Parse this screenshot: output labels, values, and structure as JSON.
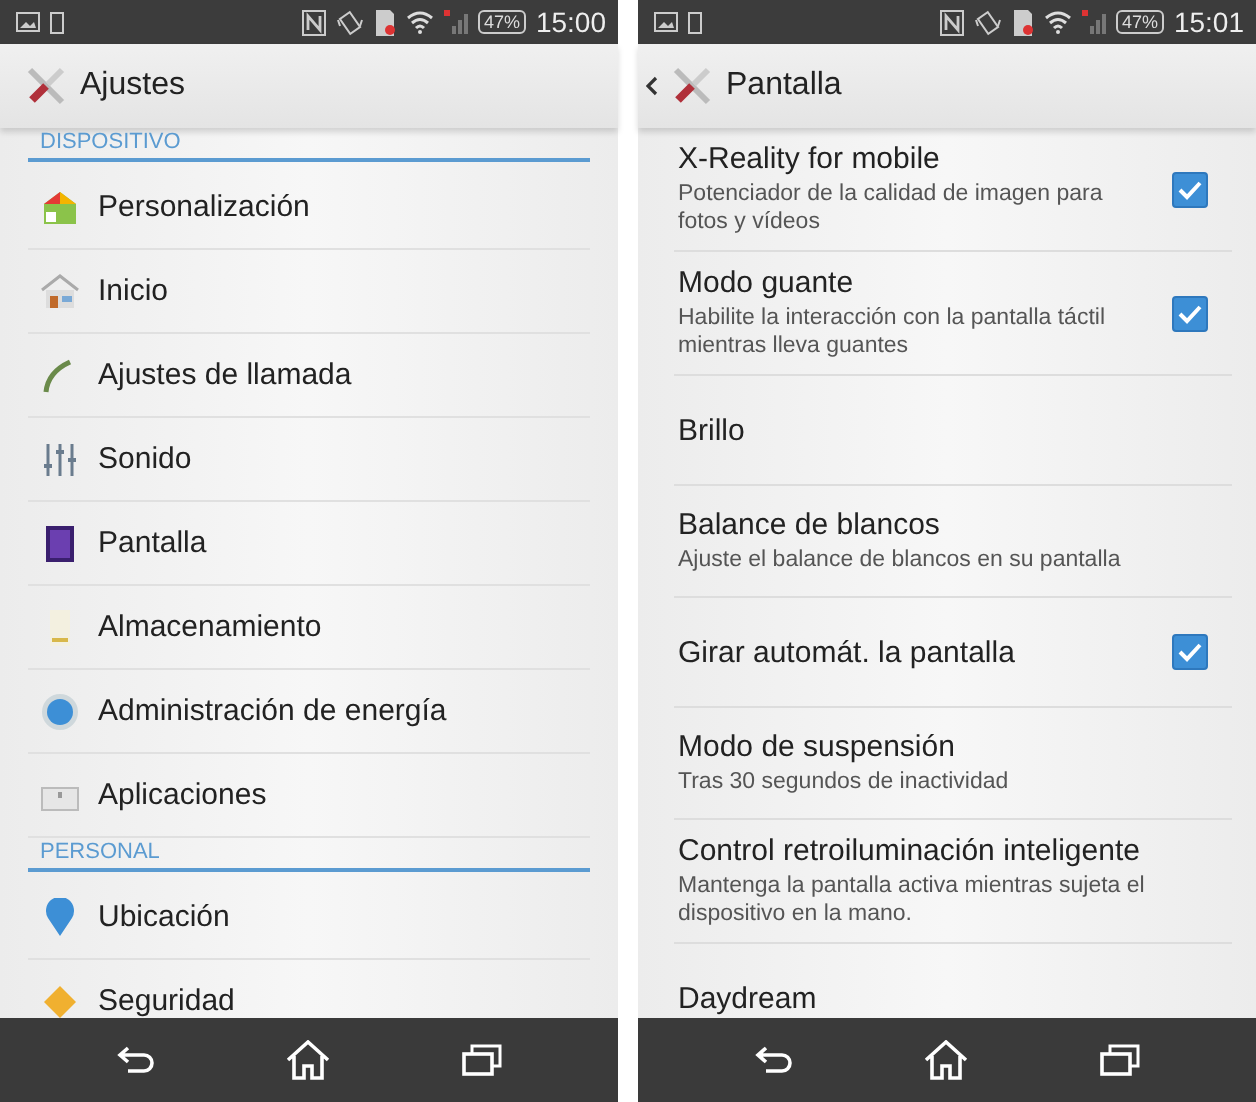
{
  "screens": [
    {
      "status_bar": {
        "battery": "47%",
        "time": "15:00"
      },
      "app_bar": {
        "title": "Ajustes",
        "back": false
      },
      "sections": [
        {
          "header": "DISPOSITIVO",
          "items": [
            {
              "label": "Personalización"
            },
            {
              "label": "Inicio"
            },
            {
              "label": "Ajustes de llamada"
            },
            {
              "label": "Sonido"
            },
            {
              "label": "Pantalla"
            },
            {
              "label": "Almacenamiento"
            },
            {
              "label": "Administración de energía"
            },
            {
              "label": "Aplicaciones"
            }
          ]
        },
        {
          "header": "PERSONAL",
          "items": [
            {
              "label": "Ubicación"
            },
            {
              "label": "Seguridad"
            }
          ]
        }
      ]
    },
    {
      "status_bar": {
        "battery": "47%",
        "time": "15:01"
      },
      "app_bar": {
        "title": "Pantalla",
        "back": true
      },
      "settings": [
        {
          "kind": "checkbox",
          "title": "X-Reality for mobile",
          "summary": "Potenciador de la calidad de imagen para fotos y vídeos",
          "checked": true
        },
        {
          "kind": "checkbox",
          "title": "Modo guante",
          "summary": "Habilite la interacción con la pantalla táctil mientras lleva guantes",
          "checked": true
        },
        {
          "kind": "plain",
          "title": "Brillo"
        },
        {
          "kind": "plain",
          "title": "Balance de blancos",
          "summary": "Ajuste el balance de blancos en su pantalla"
        },
        {
          "kind": "checkbox",
          "title": "Girar automát. la pantalla",
          "checked": true
        },
        {
          "kind": "plain",
          "title": "Modo de suspensión",
          "summary": "Tras 30 segundos de inactividad"
        },
        {
          "kind": "plain",
          "title": "Control retroiluminación inteligente",
          "summary": "Mantenga la pantalla activa mientras sujeta el dispositivo en la mano."
        },
        {
          "kind": "plain",
          "title": "Daydream"
        }
      ]
    }
  ]
}
